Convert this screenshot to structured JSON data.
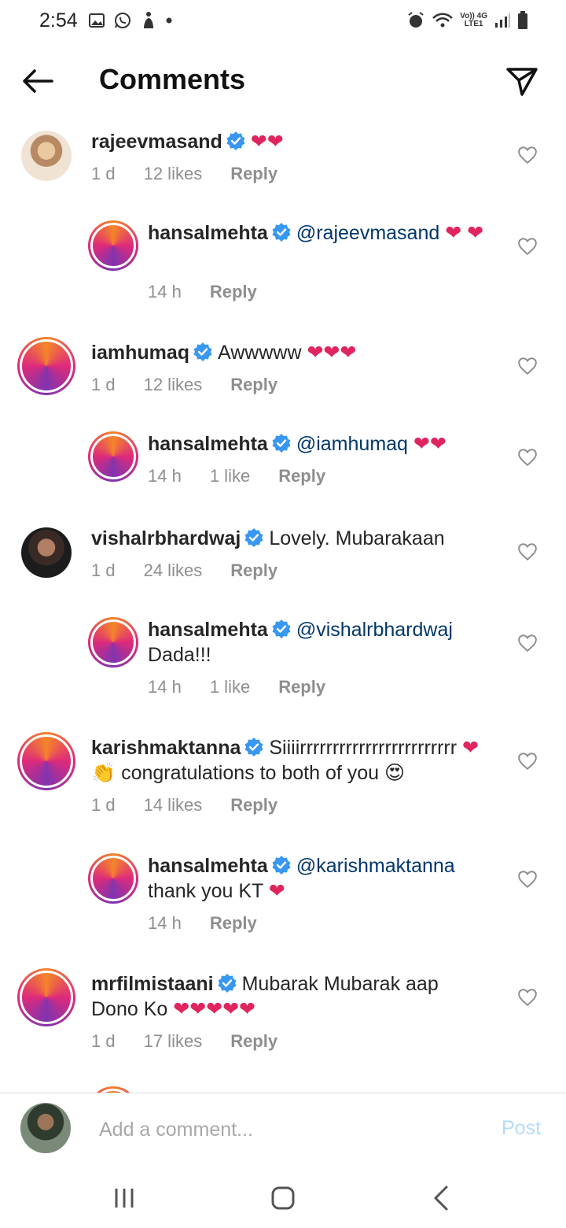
{
  "status_bar": {
    "time": "2:54",
    "net_top": "Vo)) 4G",
    "net_bottom": "LTE1"
  },
  "header": {
    "title": "Comments"
  },
  "comments": [
    {
      "user": "rajeevmasand",
      "text_parts": [
        {
          "t": "❤❤",
          "k": "heart"
        }
      ],
      "time": "1 d",
      "likes": "12 likes",
      "reply": "Reply"
    },
    {
      "user": "hansalmehta",
      "text_parts": [
        {
          "t": "@rajeevmasand",
          "k": "mention"
        },
        {
          "t": " ❤ ❤",
          "k": "heart"
        }
      ],
      "time": "14 h",
      "likes": "",
      "reply": "Reply"
    },
    {
      "user": "iamhumaq",
      "text_parts": [
        {
          "t": "Awwwww ",
          "k": "text"
        },
        {
          "t": "❤❤❤",
          "k": "heart"
        }
      ],
      "time": "1 d",
      "likes": "12 likes",
      "reply": "Reply"
    },
    {
      "user": "hansalmehta",
      "text_parts": [
        {
          "t": "@iamhumaq",
          "k": "mention"
        },
        {
          "t": " ❤❤",
          "k": "heart"
        }
      ],
      "time": "14 h",
      "likes": "1 like",
      "reply": "Reply"
    },
    {
      "user": "vishalrbhardwaj",
      "text_parts": [
        {
          "t": "Lovely. Mubarakaan",
          "k": "text"
        }
      ],
      "time": "1 d",
      "likes": "24 likes",
      "reply": "Reply"
    },
    {
      "user": "hansalmehta",
      "text_parts": [
        {
          "t": "@vishalrbhardwaj",
          "k": "mention"
        },
        {
          "t": " Dada!!!",
          "k": "text"
        }
      ],
      "time": "14 h",
      "likes": "1 like",
      "reply": "Reply"
    },
    {
      "user": "karishmaktanna",
      "text_parts": [
        {
          "t": "Siiiirrrrrrrrrrrrrrrrrrrrrrrr ",
          "k": "text"
        },
        {
          "t": "❤",
          "k": "heart"
        },
        {
          "t": "👏 congratulations to both of you 😍",
          "k": "text"
        }
      ],
      "time": "1 d",
      "likes": "14 likes",
      "reply": "Reply"
    },
    {
      "user": "hansalmehta",
      "text_parts": [
        {
          "t": "@karishmaktanna",
          "k": "mention"
        },
        {
          "t": " thank you KT ",
          "k": "text"
        },
        {
          "t": "❤",
          "k": "heart"
        }
      ],
      "time": "14 h",
      "likes": "",
      "reply": "Reply"
    },
    {
      "user": "mrfilmistaani",
      "text_parts": [
        {
          "t": "Mubarak Mubarak aap Dono Ko ",
          "k": "text"
        },
        {
          "t": "❤❤❤❤❤",
          "k": "heart"
        }
      ],
      "time": "1 d",
      "likes": "17 likes",
      "reply": "Reply"
    }
  ],
  "composer": {
    "placeholder": "Add a comment...",
    "post_label": "Post"
  },
  "icons": {
    "back": "arrow-left-icon",
    "share": "send-icon",
    "like": "heart-outline-icon",
    "verified": "verified-badge-icon"
  },
  "colors": {
    "verified": "#3897f0",
    "mention": "#00376b",
    "heart": "#e0245e",
    "meta": "#8e8e8e",
    "post": "#b3dbff"
  }
}
